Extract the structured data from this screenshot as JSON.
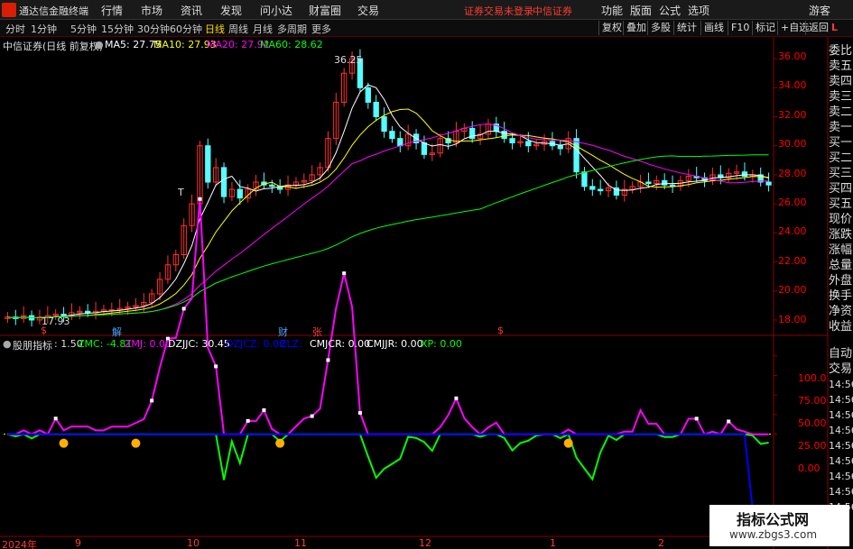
{
  "menubar": {
    "app_title": "通达信金融终端",
    "items": [
      "行情",
      "市场",
      "资讯",
      "发现",
      "问小达",
      "财富圈",
      "交易"
    ],
    "notice": "证券交易未登录",
    "broker": "中信证券",
    "right_items": [
      "功能",
      "版面",
      "公式",
      "选项"
    ],
    "guest": "游客"
  },
  "toolbar": {
    "timeframes": [
      "分时",
      "1分钟",
      "5分钟",
      "15分钟",
      "30分钟",
      "60分钟",
      "日线",
      "周线",
      "月线",
      "多周期",
      "更多"
    ],
    "active": "日线",
    "buttons": [
      "复权",
      "叠加",
      "多股",
      "统计",
      "画线",
      "F10",
      "标记",
      "+自选",
      "返回"
    ]
  },
  "main_legend": {
    "title": "中信证券(日线 前复权)",
    "ma": [
      {
        "label": "MA5: 27.75",
        "color": "#ffffff"
      },
      {
        "label": "MA10: 27.93",
        "color": "#ffff00"
      },
      {
        "label": "MA20: 27.92",
        "color": "#ff00ff"
      },
      {
        "label": "MA60: 28.62",
        "color": "#00ff00"
      }
    ]
  },
  "annotations": {
    "high": "36.25",
    "low": "17.93",
    "t_mark": "T",
    "markers": [
      {
        "label": "$",
        "color": "#ff3b30"
      },
      {
        "label": "解",
        "color": "#4aa3ff"
      },
      {
        "label": "财",
        "color": "#4aa3ff"
      },
      {
        "label": "张",
        "color": "#ff3b30"
      },
      {
        "label": "$",
        "color": "#ff3b30"
      }
    ]
  },
  "price_axis": [
    "36.00",
    "34.00",
    "32.00",
    "30.00",
    "28.00",
    "26.00",
    "24.00",
    "22.00",
    "20.00",
    "18.00"
  ],
  "indicator": {
    "name": "股朋指标",
    "value": ": 1.50",
    "items": [
      {
        "label": "ZMC: -4.81",
        "color": "#00ff00"
      },
      {
        "label": "ZMJ: 0.00",
        "color": "#ff00ff"
      },
      {
        "label": "DZJJC: 30.45",
        "color": "#ffffff"
      },
      {
        "label": "DZJCZ: 0.00",
        "color": "#0000ff"
      },
      {
        "label": "ZLZ:",
        "color": "#0000ff"
      },
      {
        "label": "CMJCR: 0.00",
        "color": "#ffffff"
      },
      {
        "label": "CMJJR: 0.00",
        "color": "#ffffff"
      },
      {
        "label": "XP: 0.00",
        "color": "#00ff00"
      }
    ],
    "axis": [
      "100.0",
      "75.00",
      "50.00",
      "25.00",
      "0.00"
    ]
  },
  "date_axis": [
    "2024年",
    "9",
    "10",
    "11",
    "12",
    "1",
    "2"
  ],
  "right_panel": {
    "labels": [
      "委比",
      "卖五",
      "卖四",
      "卖三",
      "卖二",
      "卖一",
      "买一",
      "买二",
      "买三",
      "买四",
      "买五",
      "现价",
      "涨跌",
      "涨幅",
      "总量",
      "外盘",
      "换手",
      "净资",
      "收益"
    ],
    "lower": [
      "自动",
      "交易",
      "14:56",
      "14:56",
      "14:56",
      "14:56",
      "14:56",
      "14:56",
      "14:56",
      "14:56",
      "14:56",
      "14:56",
      "14:56"
    ],
    "corner": "L"
  },
  "watermark": {
    "title": "指标公式网",
    "url": "www.zbgs3.com"
  },
  "chart_data": {
    "type": "candlestick",
    "price_range": [
      17.5,
      37
    ],
    "close": [
      18.2,
      18.1,
      18.3,
      18.0,
      18.2,
      18.3,
      18.4,
      18.3,
      18.5,
      18.6,
      18.5,
      18.6,
      18.7,
      18.7,
      18.8,
      18.9,
      19.0,
      19.2,
      19.8,
      20.8,
      21.8,
      22.5,
      24.5,
      26.0,
      30.0,
      27.5,
      28.5,
      26.5,
      27.0,
      26.4,
      27.0,
      27.5,
      27.3,
      27.2,
      27.0,
      27.3,
      27.5,
      27.6,
      28.0,
      28.5,
      30.5,
      33.0,
      35.0,
      36.0,
      34.0,
      33.0,
      32.0,
      31.0,
      30.5,
      30.0,
      30.8,
      30.2,
      29.4,
      29.5,
      30.5,
      30.2,
      31.0,
      31.2,
      30.5,
      30.8,
      31.5,
      31.0,
      30.5,
      30.2,
      30.3,
      30.0,
      30.1,
      30.3,
      30.0,
      29.8,
      30.5,
      28.2,
      27.2,
      27.0,
      26.9,
      27.1,
      26.6,
      27.0,
      27.2,
      27.5,
      27.4,
      27.6,
      27.3,
      27.2,
      27.6,
      27.9,
      27.8,
      27.6,
      28.0,
      27.8,
      28.1,
      28.2,
      27.9,
      28.0,
      27.5,
      27.3
    ],
    "ma60_color": "#00ff00",
    "indicator_series": [
      {
        "name": "ZMJ",
        "color": "#ff00ff"
      },
      {
        "name": "ZMC",
        "color": "#00ff00"
      },
      {
        "name": "DZJCZ",
        "color": "#0000ff"
      }
    ],
    "indicator_range": [
      -120,
      110
    ]
  }
}
